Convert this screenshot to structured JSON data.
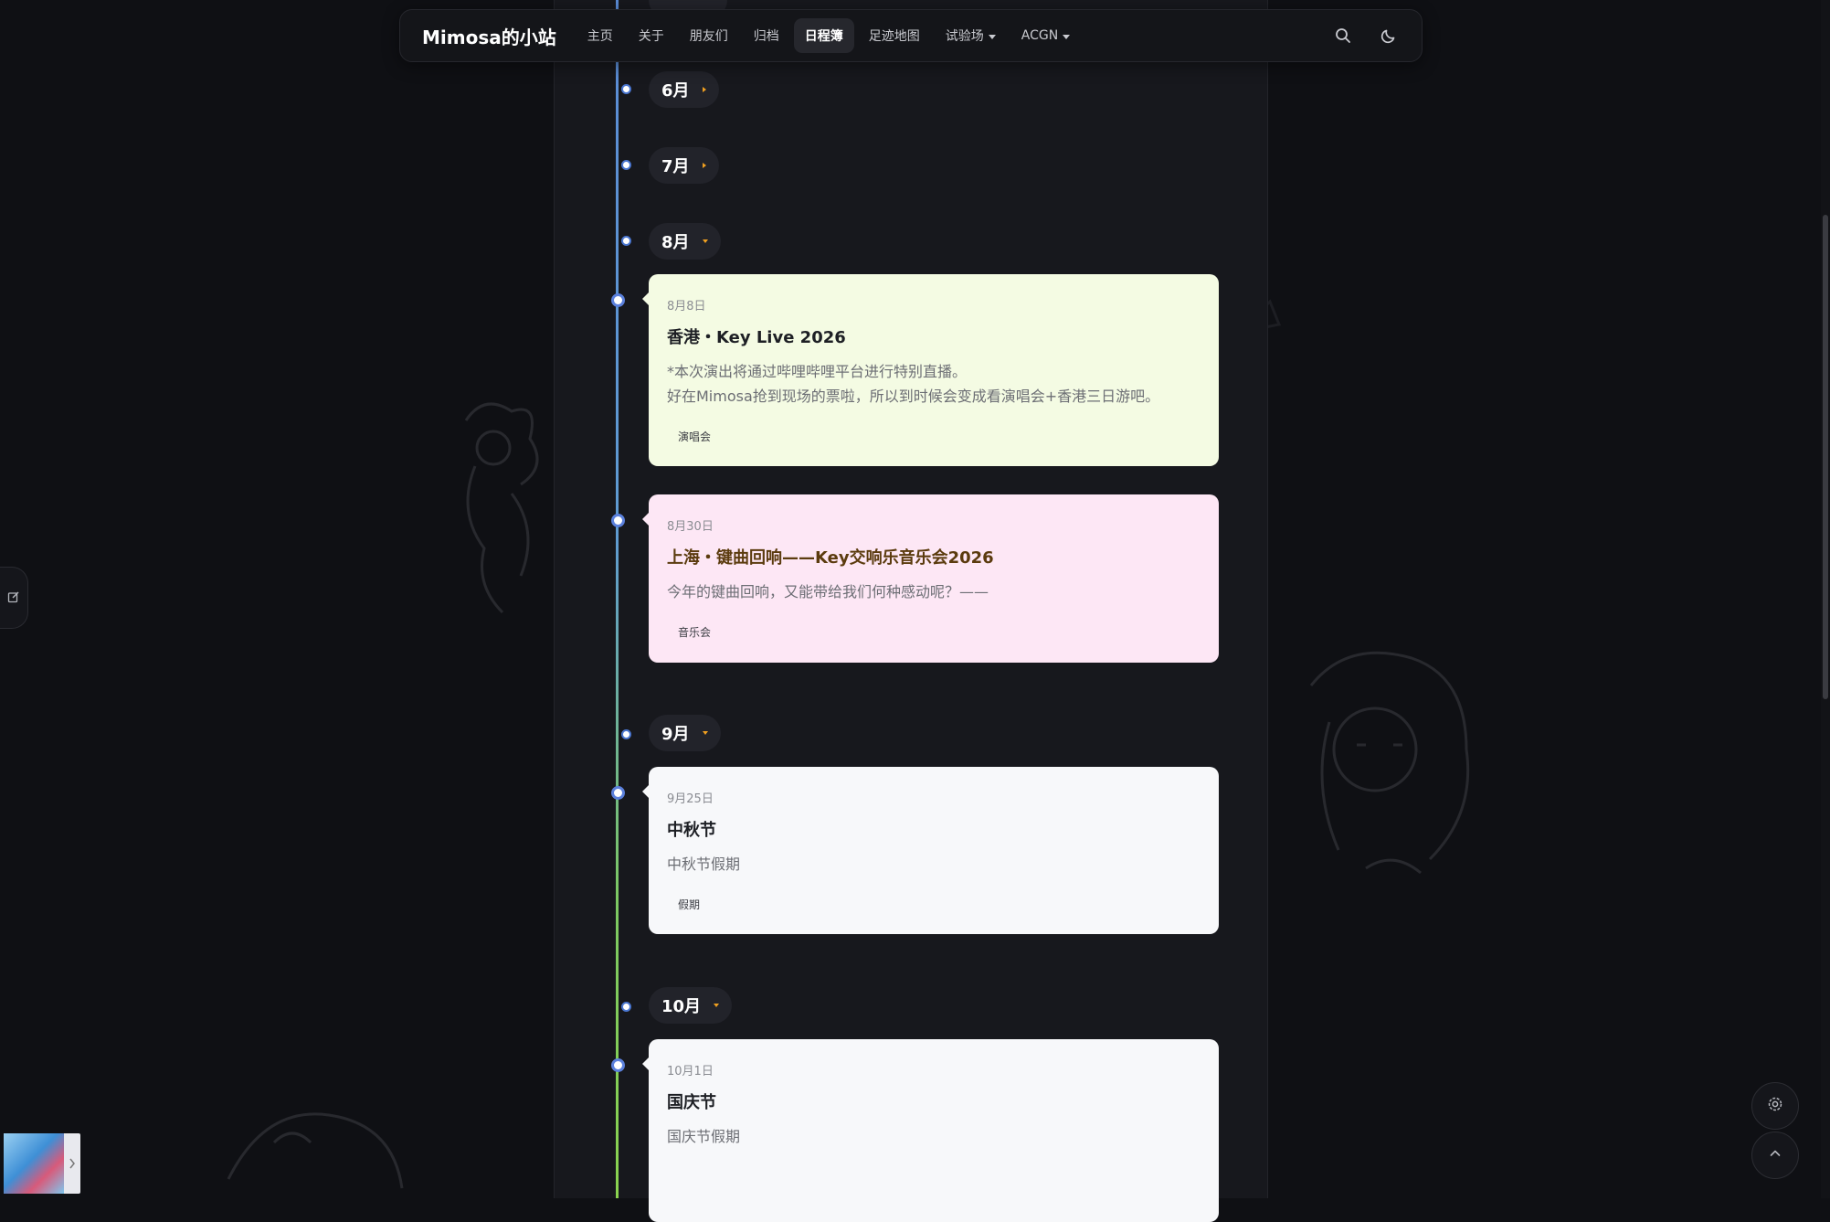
{
  "navbar": {
    "brand": "Mimosa的小站",
    "items": [
      {
        "label": "主页",
        "active": false,
        "dropdown": false
      },
      {
        "label": "关于",
        "active": false,
        "dropdown": false
      },
      {
        "label": "朋友们",
        "active": false,
        "dropdown": false
      },
      {
        "label": "归档",
        "active": false,
        "dropdown": false
      },
      {
        "label": "日程簿",
        "active": true,
        "dropdown": false
      },
      {
        "label": "足迹地图",
        "active": false,
        "dropdown": false
      },
      {
        "label": "试验场",
        "active": false,
        "dropdown": true
      },
      {
        "label": "ACGN",
        "active": false,
        "dropdown": true
      }
    ],
    "icons": {
      "search": "search-icon",
      "theme": "moon-icon"
    }
  },
  "timeline": {
    "months": [
      {
        "label": "6月",
        "expanded": false
      },
      {
        "label": "7月",
        "expanded": false
      },
      {
        "label": "8月",
        "expanded": true
      },
      {
        "label": "9月",
        "expanded": true
      },
      {
        "label": "10月",
        "expanded": true
      }
    ],
    "events": [
      {
        "date": "8月8日",
        "title": "香港・Key Live 2026",
        "desc": [
          "*本次演出将通过哔哩哔哩平台进行特别直播。",
          "好在Mimosa抢到现场的票啦，所以到时候会变成看演唱会+香港三日游吧。"
        ],
        "tag": "演唱会",
        "color": "#f4fbe3"
      },
      {
        "date": "8月30日",
        "title": "上海・键曲回响——Key交响乐音乐会2026",
        "desc": [
          "今年的键曲回响，又能带给我们何种感动呢？——"
        ],
        "tag": "音乐会",
        "color": "#fde7f5"
      },
      {
        "date": "9月25日",
        "title": "中秋节",
        "desc": [
          "中秋节假期"
        ],
        "tag": "假期",
        "color": "#f7f8fa"
      },
      {
        "date": "10月1日",
        "title": "国庆节",
        "desc": [
          "国庆节假期"
        ],
        "tag": "",
        "color": "#f7f8fa"
      }
    ]
  },
  "colors": {
    "timeline_top": "#5a8bd6",
    "timeline_bottom": "#8ad34f",
    "month_caret": "#f0a020",
    "event_dot": "#5b80dc"
  },
  "floating": {
    "settings_icon": "gear-icon",
    "back_to_top_icon": "chevron-up-icon",
    "side_tab_icon": "edit-icon",
    "music_arrow_icon": "chevron-right-icon"
  }
}
